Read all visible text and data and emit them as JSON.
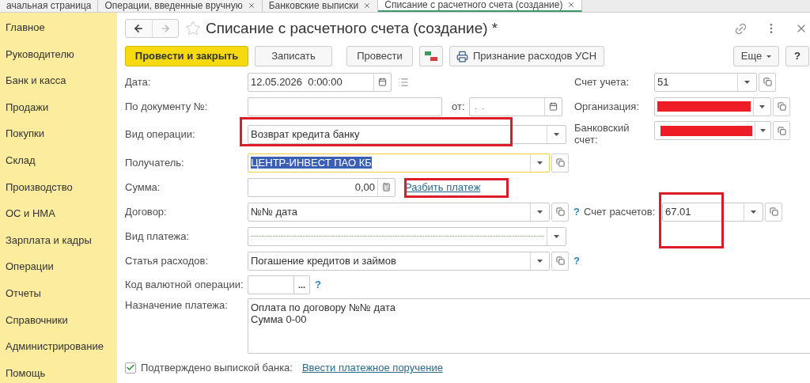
{
  "tabs": [
    {
      "label": "ачальная страница",
      "selected": false,
      "closable": false
    },
    {
      "label": "Операции, введенные вручную",
      "selected": false,
      "closable": true
    },
    {
      "label": "Банковские выписки",
      "selected": false,
      "closable": true
    },
    {
      "label": "Списание с расчетного счета (создание)",
      "selected": true,
      "closable": true
    }
  ],
  "sidebar": {
    "items": [
      "Главное",
      "Руководителю",
      "Банк и касса",
      "Продажи",
      "Покупки",
      "Склад",
      "Производство",
      "ОС и НМА",
      "Зарплата и кадры",
      "Операции",
      "Отчеты",
      "Справочники",
      "Администрирование",
      "Помощь"
    ]
  },
  "form": {
    "title": "Списание с расчетного счета (создание) *",
    "toolbar": {
      "primary": "Провести и закрыть",
      "write": "Записать",
      "post": "Провести",
      "usn": "Признание расходов УСН",
      "more": "Еще",
      "help": "?"
    },
    "date": {
      "label": "Дата:",
      "value": "12.05.2026  0:00:00"
    },
    "account": {
      "label": "Счет учета:",
      "value": "51"
    },
    "doc_number": {
      "label": "По документу №:",
      "from_label": "от:",
      "from_value": " .  ."
    },
    "organization": {
      "label": "Организация:"
    },
    "operation": {
      "label": "Вид операции:",
      "value": "Возврат кредита банку"
    },
    "bank_account": {
      "label": "Банковский счет:"
    },
    "recipient": {
      "label": "Получатель:",
      "value": "ЦЕНТР-ИНВЕСТ ПАО КБ",
      "focused": true
    },
    "amount": {
      "label": "Сумма:",
      "value": "0,00",
      "link": "Разбить платеж"
    },
    "contract": {
      "label": "Договор:",
      "value": "№№ дата",
      "help": "?"
    },
    "settlement_account": {
      "label": "Счет расчетов:",
      "value": "67.01"
    },
    "payment_type": {
      "label": "Вид платежа:"
    },
    "expense_item": {
      "label": "Статья расходов:",
      "value": "Погашение кредитов и займов",
      "help": "?"
    },
    "currency_code": {
      "label": "Код валютной операции:",
      "button": "...",
      "help": "?"
    },
    "purpose": {
      "label": "Назначение платежа:",
      "lines": [
        "Оплата по договору №№ дата",
        "Сумма 0-00"
      ]
    },
    "confirmed": {
      "label": "Подтверждено выпиской банка:",
      "checked": true,
      "link": "Ввести платежное поручение"
    }
  }
}
